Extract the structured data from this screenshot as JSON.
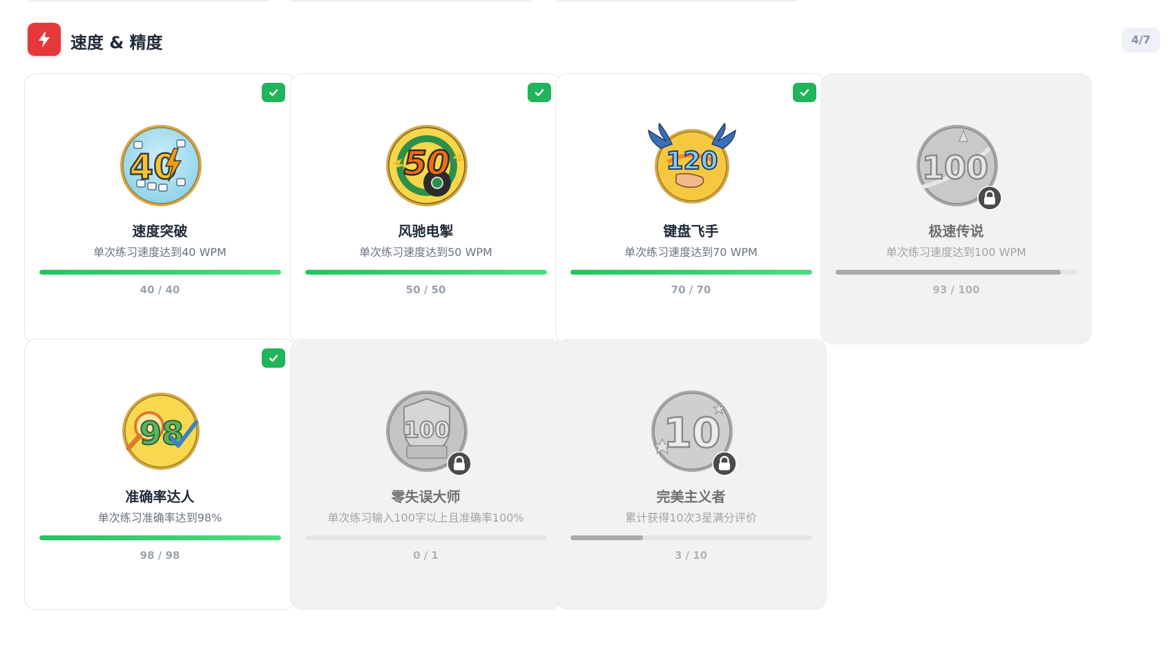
{
  "section": {
    "title": "速度 & 精度",
    "icon": "lightning-icon",
    "count": "4/7",
    "accent": "#e5383b"
  },
  "colors": {
    "unlocked_border": "#d7ece5",
    "locked_bg": "#f2f2f2",
    "progress_green": "#22c55e",
    "progress_gray": "#aaaaaa",
    "check_green": "#22b45a"
  },
  "achievements": [
    {
      "title": "速度突破",
      "desc": "单次练习速度达到40 WPM",
      "progress_text": "40 / 40",
      "progress": 1.0,
      "unlocked": true,
      "medal": "speed-40-medal",
      "medal_label": "40"
    },
    {
      "title": "风驰电掣",
      "desc": "单次练习速度达到50 WPM",
      "progress_text": "50 / 50",
      "progress": 1.0,
      "unlocked": true,
      "medal": "speed-50-medal",
      "medal_label": "50"
    },
    {
      "title": "键盘飞手",
      "desc": "单次练习速度达到70 WPM",
      "progress_text": "70 / 70",
      "progress": 1.0,
      "unlocked": true,
      "medal": "winged-120-medal",
      "medal_label": "120"
    },
    {
      "title": "极速传说",
      "desc": "单次练习速度达到100 WPM",
      "progress_text": "93 / 100",
      "progress": 0.93,
      "unlocked": false,
      "medal": "speed-100-medal",
      "medal_label": "100"
    },
    {
      "title": "准确率达人",
      "desc": "单次练习准确率达到98%",
      "progress_text": "98 / 98",
      "progress": 1.0,
      "unlocked": true,
      "medal": "accuracy-98-medal",
      "medal_label": "98"
    },
    {
      "title": "零失误大师",
      "desc": "单次练习输入100字以上且准确率100%",
      "progress_text": "0 / 1",
      "progress": 0.0,
      "unlocked": false,
      "medal": "perfect-100-shield-medal",
      "medal_label": "100"
    },
    {
      "title": "完美主义者",
      "desc": "累计获得10次3星满分评价",
      "progress_text": "3 / 10",
      "progress": 0.3,
      "unlocked": false,
      "medal": "perfect-10-medal",
      "medal_label": "10"
    }
  ]
}
